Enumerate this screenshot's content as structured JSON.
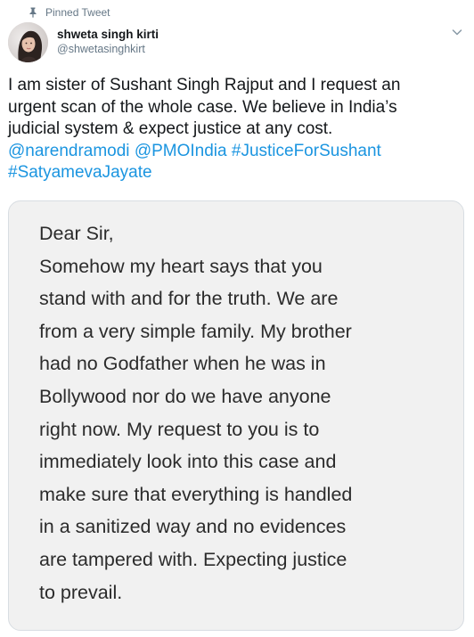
{
  "pinned_label": "Pinned Tweet",
  "author": {
    "display_name": "shweta singh kirti",
    "handle": "@shwetasinghkirt"
  },
  "tweet": {
    "line1": "I am sister of Sushant Singh Rajput and I request an",
    "line2": "urgent scan of the whole case. We believe in India’s",
    "line3": "judicial system & expect justice at any cost.",
    "mention1": "@narendramodi",
    "mention2": "@PMOIndia",
    "hashtag1": "#JusticeForSushant",
    "hashtag2": "#SatyamevaJayate"
  },
  "letter_lines": [
    "Dear Sir,",
    "Somehow my heart says that you",
    "stand with and for the truth. We are",
    "from a very simple family. My brother",
    "had no Godfather when he was in",
    "Bollywood nor do we have anyone",
    "right now. My request to you is to",
    "immediately look into this case and",
    "make sure that everything is handled",
    "in a sanitized way and no evidences",
    "are tampered with.  Expecting justice",
    "to prevail."
  ],
  "icons": {
    "pin": "pin-icon",
    "caret": "chevron-down-icon"
  },
  "colors": {
    "link": "#1b95e0",
    "secondary_text": "#657786",
    "media_background": "#f1f1f1"
  }
}
